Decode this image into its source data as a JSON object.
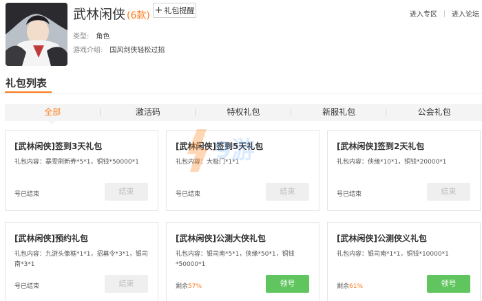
{
  "game": {
    "name": "武林闲侠",
    "count": "(6款)",
    "remind_label": "礼包提醒",
    "type_label": "类型:",
    "type_value": "角色",
    "intro_label": "游戏介绍:",
    "intro_value": "国风剑侠轻松过招"
  },
  "top_links": [
    "进入专区",
    "进入论坛"
  ],
  "section": {
    "title": "礼包列表"
  },
  "tabs": [
    {
      "label": "全部",
      "active": true
    },
    {
      "label": "激活码",
      "active": false
    },
    {
      "label": "特权礼包",
      "active": false
    },
    {
      "label": "新服礼包",
      "active": false
    },
    {
      "label": "公会礼包",
      "active": false
    }
  ],
  "cards": [
    {
      "title": "[武林闲侠]签到3天礼包",
      "content": "礼包内容：暴雯刷新券*5*1，铜钱*50000*1",
      "status": "号已结束",
      "button": "结束",
      "button_state": "ended"
    },
    {
      "title": "[武林闲侠]签到5天礼包",
      "content": "礼包内容：大极门*1*1",
      "status": "号已结束",
      "button": "结束",
      "button_state": "ended"
    },
    {
      "title": "[武林闲侠]签到2天礼包",
      "content": "礼包内容：侠缘*10*1，铜钱*20000*1",
      "status": "号已结束",
      "button": "结束",
      "button_state": "ended"
    },
    {
      "title": "[武林闲侠]预约礼包",
      "content": "礼包内容：九游头像框*1*1，招募令*3*1，银司南*3*1",
      "status": "号已结束",
      "button": "结束",
      "button_state": "ended"
    },
    {
      "title": "[武林闲侠]公测大侠礼包",
      "content": "礼包内容：银司南*5*1，侠缘*50*1，铜钱*50000*1",
      "status_prefix": "剩余",
      "status_value": "57%",
      "button": "领号",
      "button_state": "claim"
    },
    {
      "title": "[武林闲侠]公测侠义礼包",
      "content": "礼包内容：银司南*1*1，铜钱*10000*1",
      "status_prefix": "剩余",
      "status_value": "61%",
      "button": "领号",
      "button_state": "claim"
    }
  ],
  "watermark": {
    "text": "9游"
  },
  "colors": {
    "accent": "#ff7a1a",
    "claim_green": "#60c55f",
    "ended_gray": "#efefef"
  }
}
